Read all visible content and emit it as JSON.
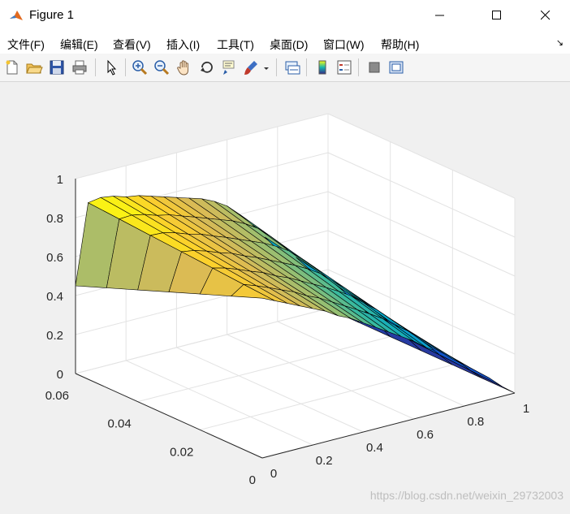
{
  "window": {
    "title": "Figure 1",
    "minimize_glyph": "—",
    "maximize_glyph": "☐",
    "close_glyph": "✕"
  },
  "menu": {
    "items": [
      "文件(F)",
      "编辑(E)",
      "查看(V)",
      "插入(I)",
      "工具(T)",
      "桌面(D)",
      "窗口(W)",
      "帮助(H)"
    ],
    "overflow_glyph": "↘"
  },
  "toolbar": {
    "buttons": [
      "new-figure",
      "open-file",
      "save",
      "print",
      "edit-plot",
      "zoom-in",
      "zoom-out",
      "pan",
      "rotate-3d",
      "data-cursor",
      "brush",
      "brush-dropdown",
      "link-plot",
      "insert-colorbar",
      "insert-legend",
      "hide-plot-tools",
      "show-plot-tools"
    ]
  },
  "watermark": "https://blog.csdn.net/weixin_29732003",
  "chart_data": {
    "type": "surface",
    "title": "",
    "xlabel": "",
    "ylabel": "",
    "zlabel": "",
    "x_ticks": [
      "0",
      "0.2",
      "0.4",
      "0.6",
      "0.8",
      "1"
    ],
    "y_ticks": [
      "0",
      "0.02",
      "0.04",
      "0.06"
    ],
    "z_ticks": [
      "0",
      "0.2",
      "0.4",
      "0.6",
      "0.8",
      "1"
    ],
    "xlim": [
      0,
      1
    ],
    "ylim": [
      0,
      0.06
    ],
    "zlim": [
      0,
      1
    ],
    "grid": true,
    "colormap": "parula",
    "view": "3d default",
    "x": [
      0,
      0.05,
      0.1,
      0.15,
      0.2,
      0.25,
      0.3,
      0.35,
      0.4,
      0.45,
      0.5,
      0.55,
      0.6,
      0.65,
      0.7,
      0.75,
      0.8,
      0.85,
      0.9,
      0.95,
      1
    ],
    "y": [
      0,
      0.01,
      0.02,
      0.03,
      0.04,
      0.05,
      0.06
    ],
    "profile_y0": [
      0.82,
      0.79,
      0.76,
      0.73,
      0.7,
      0.67,
      0.63,
      0.6,
      0.56,
      0.52,
      0.48,
      0.44,
      0.4,
      0.35,
      0.31,
      0.26,
      0.21,
      0.16,
      0.11,
      0.05,
      0.0
    ],
    "profile_y006": [
      0.45,
      0.86,
      0.87,
      0.86,
      0.84,
      0.83,
      0.81,
      0.79,
      0.77,
      0.75,
      0.73,
      0.7,
      0.66,
      0.6,
      0.53,
      0.45,
      0.37,
      0.28,
      0.19,
      0.1,
      0.0
    ]
  }
}
